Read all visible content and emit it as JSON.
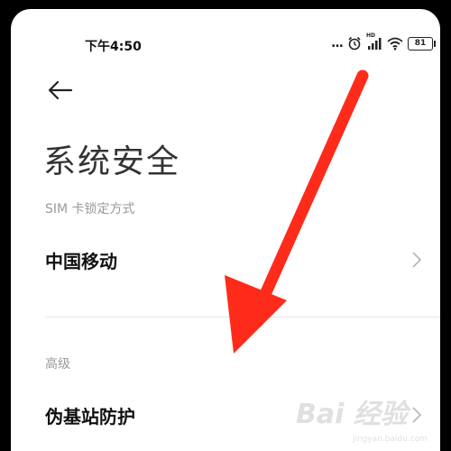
{
  "status_bar": {
    "time": "下午4:50",
    "dots": "...",
    "battery": "81",
    "hd_label": "HD"
  },
  "icons": {
    "back": "back-arrow-icon",
    "chevron": "chevron-right-icon",
    "alarm": "alarm-icon",
    "signal": "signal-icon",
    "wifi": "wifi-icon"
  },
  "page": {
    "title": "系统安全"
  },
  "sim_section": {
    "label": "SIM 卡锁定方式",
    "items": [
      {
        "label": "中国移动"
      }
    ]
  },
  "advanced_section": {
    "label": "高级",
    "items": [
      {
        "label": "伪基站防护"
      }
    ]
  },
  "annotation": {
    "arrow_color": "#ff2b1a"
  },
  "watermark": {
    "text": "Bai 经验",
    "sub": "jingyan.baidu.com"
  },
  "colors": {
    "background": "#ffffff",
    "section_label": "#9a9a9a",
    "item_text": "#111111",
    "title_text": "#333333"
  }
}
